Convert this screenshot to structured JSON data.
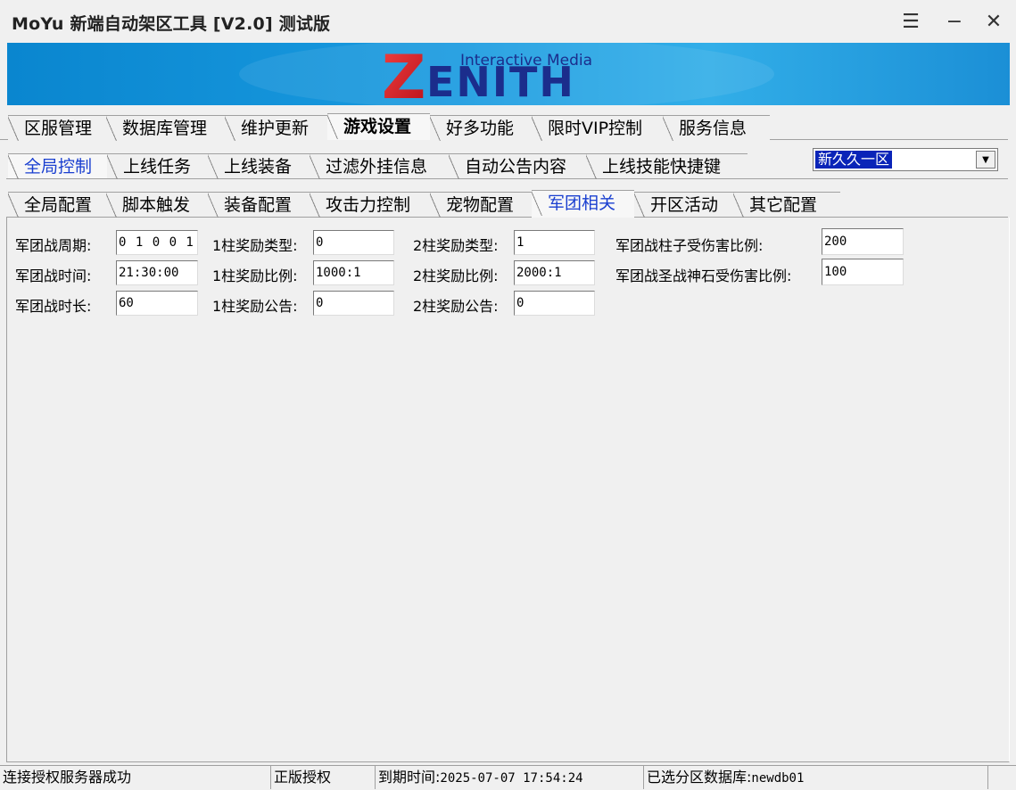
{
  "window": {
    "title": "MoYu 新端自动架区工具 [V2.0] 测试版",
    "menu_glyph": "☰",
    "minimize_glyph": "−",
    "close_glyph": "✕"
  },
  "banner": {
    "logo_letter_z": "Z",
    "logo_rest": "ENITH",
    "tagline": "Interactive Media",
    "colors": {
      "bg": "#1a9be0",
      "z_red": "#e01c24",
      "z_blue": "#1b3a9c",
      "text": "#1b2d8c"
    }
  },
  "main_tabs": [
    {
      "label": "区服管理"
    },
    {
      "label": "数据库管理"
    },
    {
      "label": "维护更新"
    },
    {
      "label": "游戏设置"
    },
    {
      "label": "好多功能"
    },
    {
      "label": "限时VIP控制"
    },
    {
      "label": "服务信息"
    }
  ],
  "sub_tabs": [
    {
      "label": "全局控制"
    },
    {
      "label": "上线任务"
    },
    {
      "label": "上线装备"
    },
    {
      "label": "过滤外挂信息"
    },
    {
      "label": "自动公告内容"
    },
    {
      "label": "上线技能快捷键"
    }
  ],
  "server_select": {
    "value": "新久久一区"
  },
  "config_tabs": [
    {
      "label": "全局配置"
    },
    {
      "label": "脚本触发"
    },
    {
      "label": "装备配置"
    },
    {
      "label": "攻击力控制"
    },
    {
      "label": "宠物配置"
    },
    {
      "label": "军团相关"
    },
    {
      "label": "开区活动"
    },
    {
      "label": "其它配置"
    }
  ],
  "form": {
    "war_period_label": "军团战周期:",
    "war_period_value": "0 1 0 0 1",
    "war_time_label": "军团战时间:",
    "war_time_value": "21:30:00",
    "war_duration_label": "军团战时长:",
    "war_duration_value": "60",
    "p1_type_label": "1柱奖励类型:",
    "p1_type_value": "0",
    "p1_ratio_label": "1柱奖励比例:",
    "p1_ratio_value": "1000:1",
    "p1_notice_label": "1柱奖励公告:",
    "p1_notice_value": "0",
    "p2_type_label": "2柱奖励类型:",
    "p2_type_value": "1",
    "p2_ratio_label": "2柱奖励比例:",
    "p2_ratio_value": "2000:1",
    "p2_notice_label": "2柱奖励公告:",
    "p2_notice_value": "0",
    "pillar_dmg_label": "军团战柱子受伤害比例:",
    "pillar_dmg_value": "200",
    "stone_dmg_label": "军团战圣战神石受伤害比例:",
    "stone_dmg_value": "100"
  },
  "status_bar": {
    "connection": "连接授权服务器成功",
    "license": "正版授权",
    "expiry_label": "到期时间:",
    "expiry_value": "2025-07-07 17:54:24",
    "db_label": "已选分区数据库:",
    "db_value": "newdb01"
  }
}
